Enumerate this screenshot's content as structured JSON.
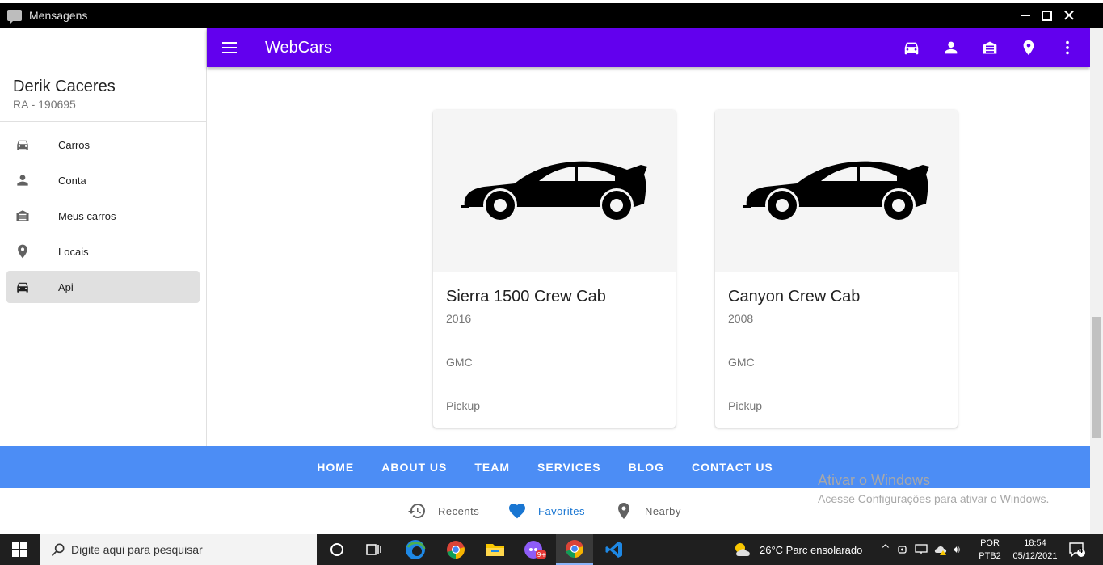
{
  "window": {
    "title": "Mensagens"
  },
  "drawer": {
    "user_name": "Derik Caceres",
    "user_sub": "RA - 190695",
    "items": [
      {
        "label": "Carros",
        "icon": "car-icon"
      },
      {
        "label": "Conta",
        "icon": "person-icon"
      },
      {
        "label": "Meus carros",
        "icon": "garage-icon"
      },
      {
        "label": "Locais",
        "icon": "location-icon"
      },
      {
        "label": "Api",
        "icon": "car-icon",
        "active": true
      }
    ]
  },
  "appbar": {
    "title": "WebCars",
    "color": "#6200ee",
    "actions": [
      "car-icon",
      "person-icon",
      "garage-icon",
      "location-icon",
      "more-vert-icon"
    ]
  },
  "cards": [
    {
      "title": "Sierra 1500 Crew Cab",
      "year": "2016",
      "brand": "GMC",
      "type": "Pickup"
    },
    {
      "title": "Canyon Crew Cab",
      "year": "2008",
      "brand": "GMC",
      "type": "Pickup"
    }
  ],
  "footer": {
    "color": "#4c8df5",
    "links": [
      "HOME",
      "ABOUT US",
      "TEAM",
      "SERVICES",
      "BLOG",
      "CONTACT US"
    ]
  },
  "bottom_nav": [
    {
      "label": "Recents",
      "icon": "history-icon"
    },
    {
      "label": "Favorites",
      "icon": "heart-icon",
      "active": true
    },
    {
      "label": "Nearby",
      "icon": "location-icon"
    }
  ],
  "watermark": {
    "line1": "Ativar o Windows",
    "line2": "Acesse Configurações para ativar o Windows."
  },
  "taskbar": {
    "search_placeholder": "Digite aqui para pesquisar",
    "weather": "26°C  Parc ensolarado",
    "lang_top": "POR",
    "lang_bottom": "PTB2",
    "time": "18:54",
    "date": "05/12/2021",
    "notifications": "4"
  }
}
